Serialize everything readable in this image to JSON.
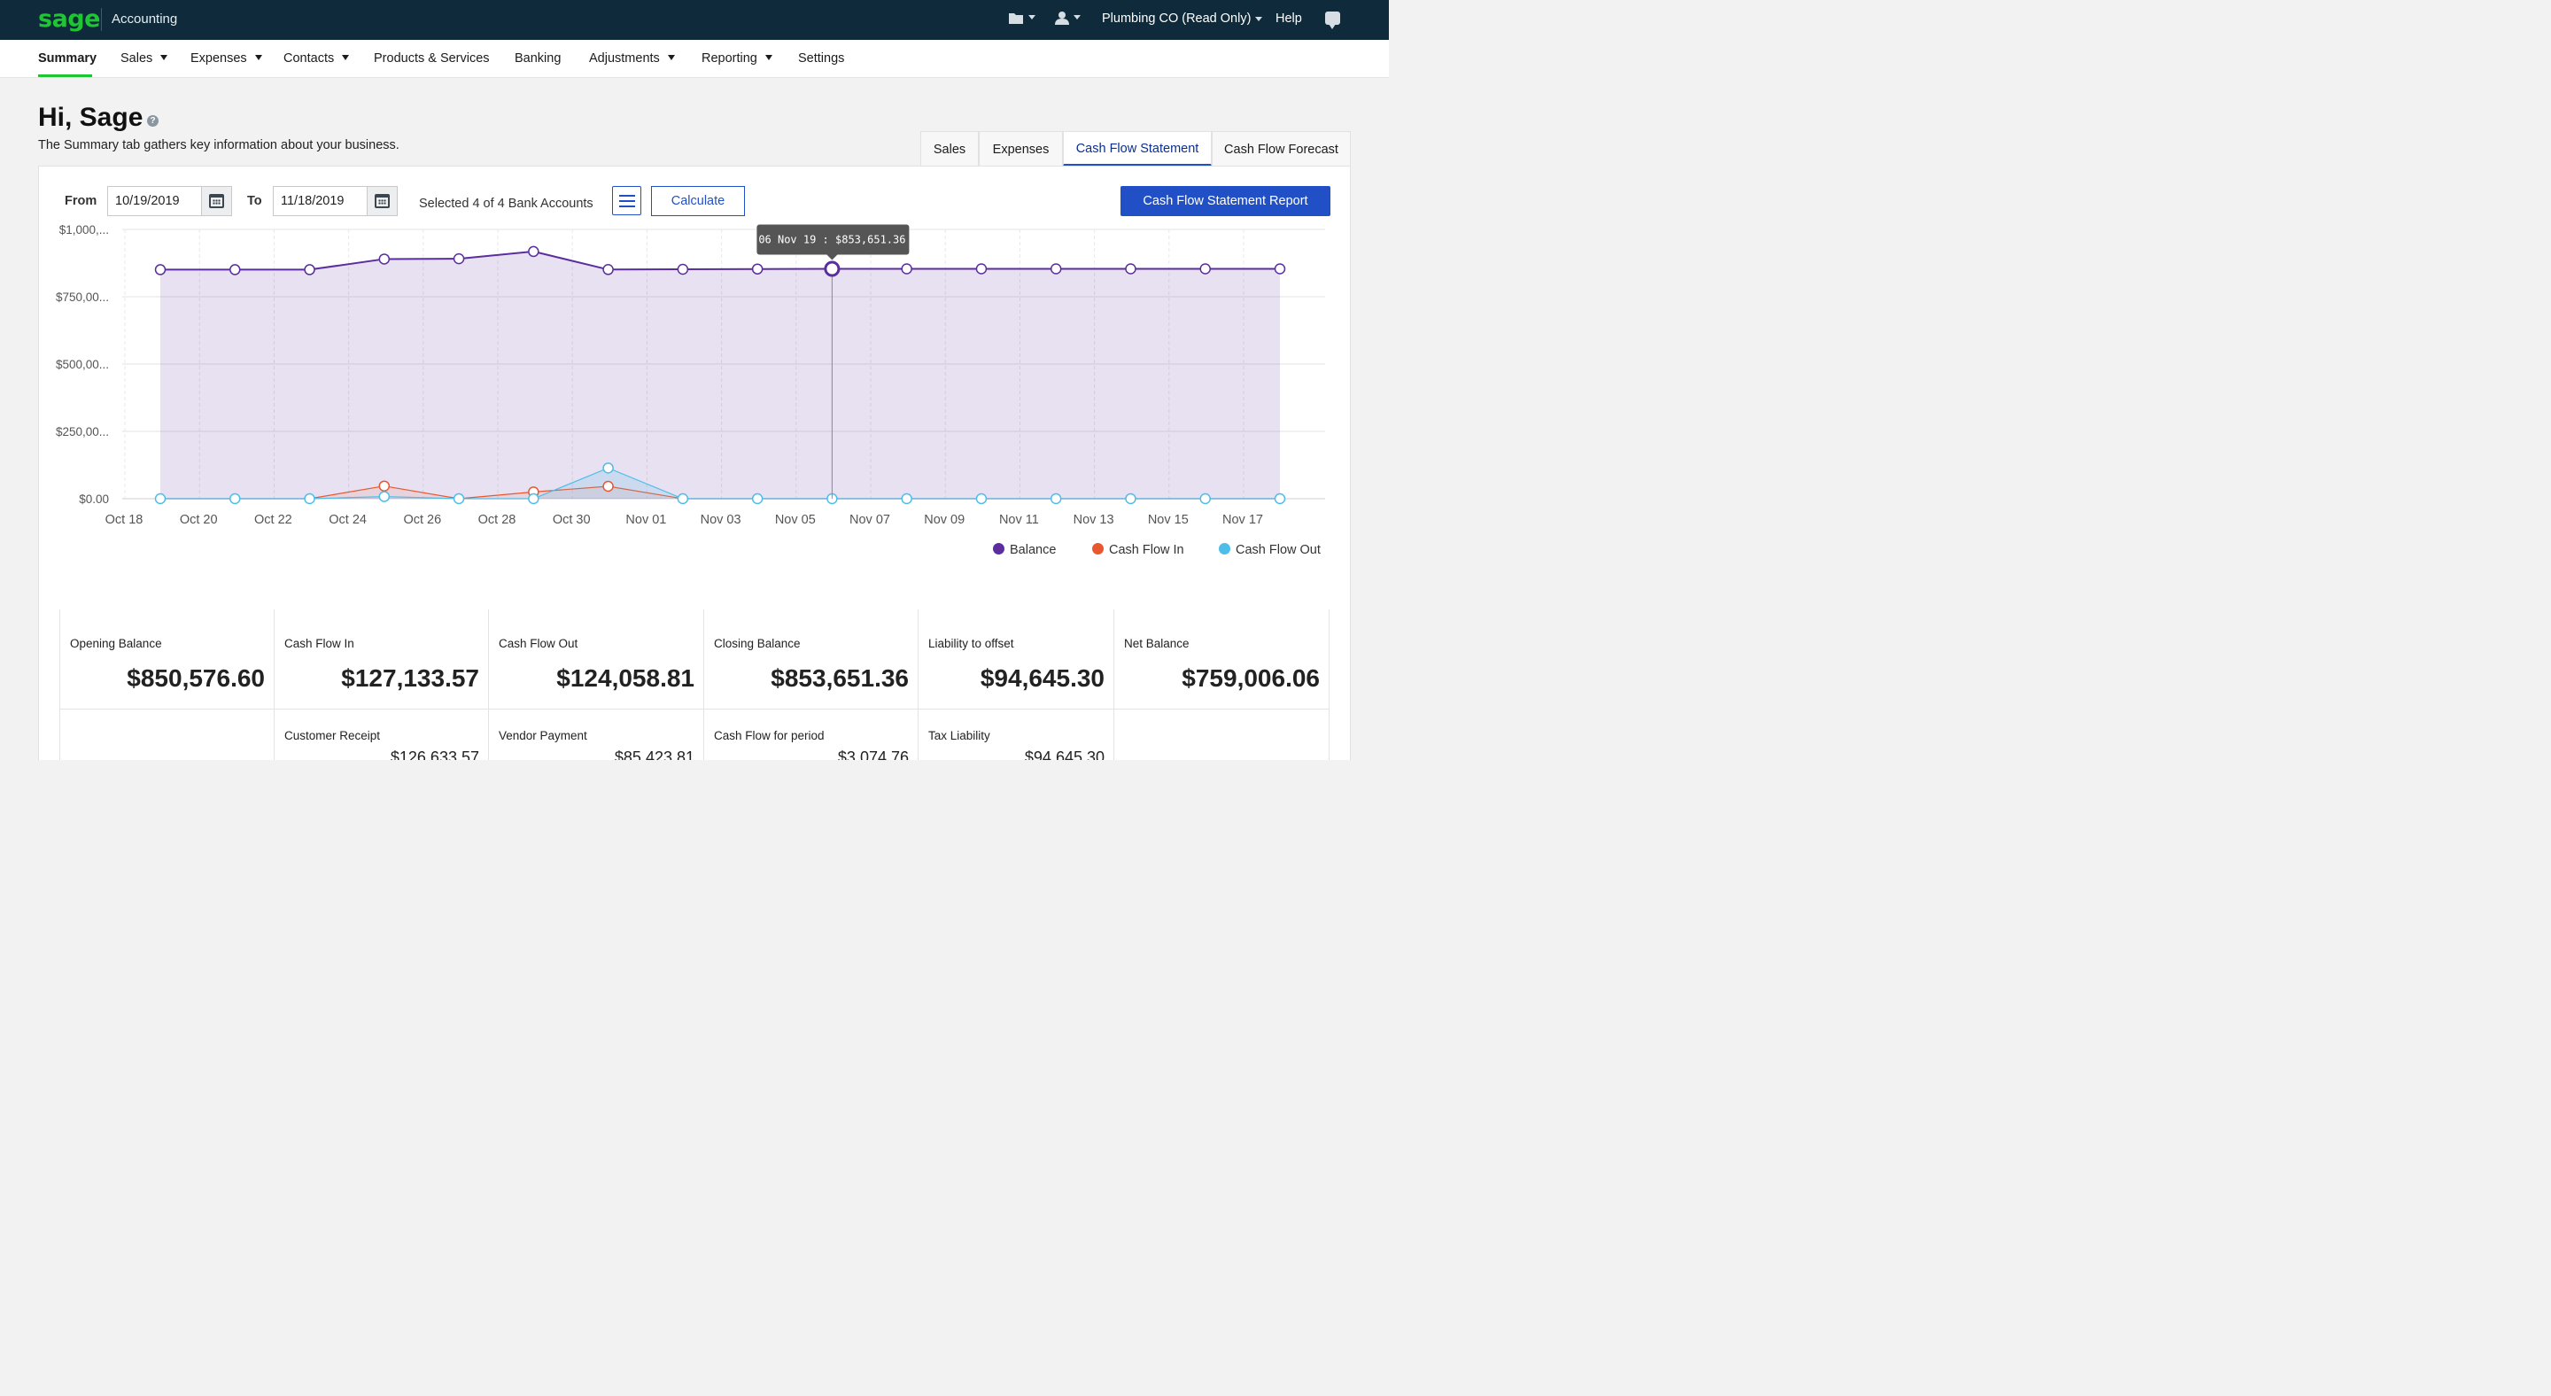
{
  "topbar": {
    "logo": "sage",
    "app_name": "Accounting",
    "company": "Plumbing CO (Read Only)",
    "help": "Help",
    "icons": [
      "folder-icon",
      "user-icon",
      "chat-icon"
    ]
  },
  "nav": {
    "items": [
      {
        "label": "Summary",
        "dropdown": false,
        "active": true
      },
      {
        "label": "Sales",
        "dropdown": true
      },
      {
        "label": "Expenses",
        "dropdown": true
      },
      {
        "label": "Contacts",
        "dropdown": true
      },
      {
        "label": "Products & Services",
        "dropdown": false
      },
      {
        "label": "Banking",
        "dropdown": false
      },
      {
        "label": "Adjustments",
        "dropdown": true
      },
      {
        "label": "Reporting",
        "dropdown": true
      },
      {
        "label": "Settings",
        "dropdown": false
      }
    ]
  },
  "page": {
    "greeting": "Hi, Sage",
    "help_glyph": "?",
    "subtitle": "The Summary tab gathers key information about your business."
  },
  "tabs": [
    {
      "label": "Sales",
      "active": false
    },
    {
      "label": "Expenses",
      "active": false
    },
    {
      "label": "Cash Flow Statement",
      "active": true
    },
    {
      "label": "Cash Flow Forecast",
      "active": false
    }
  ],
  "filters": {
    "from_label": "From",
    "from_value": "10/19/2019",
    "to_label": "To",
    "to_value": "11/18/2019",
    "selected_accounts": "Selected 4 of 4 Bank Accounts",
    "calculate_label": "Calculate",
    "report_label": "Cash Flow Statement Report"
  },
  "chart_data": {
    "type": "area",
    "ytick_labels": [
      "$1,000,...",
      "$750,00...",
      "$500,00...",
      "$250,00...",
      "$0.00"
    ],
    "ytick_values": [
      1000000,
      750000,
      500000,
      250000,
      0
    ],
    "ylim": [
      0,
      1000000
    ],
    "xtick_labels": [
      "Oct 18",
      "Oct 20",
      "Oct 22",
      "Oct 24",
      "Oct 26",
      "Oct 28",
      "Oct 30",
      "Nov 01",
      "Nov 03",
      "Nov 05",
      "Nov 07",
      "Nov 09",
      "Nov 11",
      "Nov 13",
      "Nov 15",
      "Nov 17"
    ],
    "x": [
      "Oct 19",
      "Oct 21",
      "Oct 23",
      "Oct 25",
      "Oct 27",
      "Oct 29",
      "Oct 31",
      "Nov 02",
      "Nov 04",
      "Nov 06",
      "Nov 08",
      "Nov 10",
      "Nov 12",
      "Nov 14",
      "Nov 16",
      "Nov 18"
    ],
    "series": [
      {
        "name": "Balance",
        "color": "#5b2d9e",
        "values": [
          850577,
          850577,
          850577,
          890000,
          891000,
          918000,
          851000,
          852000,
          853000,
          853651,
          853651,
          853651,
          853651,
          853651,
          853651,
          853651
        ]
      },
      {
        "name": "Cash Flow In",
        "color": "#e8572f",
        "values": [
          0,
          0,
          0,
          47000,
          0,
          25000,
          46000,
          0,
          0,
          0,
          0,
          0,
          0,
          0,
          0,
          0
        ]
      },
      {
        "name": "Cash Flow Out",
        "color": "#4dbde9",
        "values": [
          0,
          0,
          0,
          8000,
          0,
          0,
          114000,
          0,
          0,
          0,
          0,
          0,
          0,
          0,
          0,
          0
        ]
      }
    ],
    "tooltip": {
      "label": "06 Nov 19 :  $853,651.36",
      "index": 9
    },
    "grid": true,
    "legend": "bottom-right"
  },
  "summary": {
    "cards": [
      {
        "title": "Opening Balance",
        "value": "$850,576.60",
        "sub_title": "",
        "sub_value": ""
      },
      {
        "title": "Cash Flow In",
        "value": "$127,133.57",
        "sub_title": "Customer Receipt",
        "sub_value": "$126,633.57"
      },
      {
        "title": "Cash Flow Out",
        "value": "$124,058.81",
        "sub_title": "Vendor Payment",
        "sub_value": "$85,423.81"
      },
      {
        "title": "Closing Balance",
        "value": "$853,651.36",
        "sub_title": "Cash Flow for period",
        "sub_value": "$3,074.76"
      },
      {
        "title": "Liability to offset",
        "value": "$94,645.30",
        "sub_title": "Tax Liability",
        "sub_value": "$94,645.30"
      },
      {
        "title": "Net Balance",
        "value": "$759,006.06",
        "sub_title": "",
        "sub_value": ""
      }
    ]
  }
}
